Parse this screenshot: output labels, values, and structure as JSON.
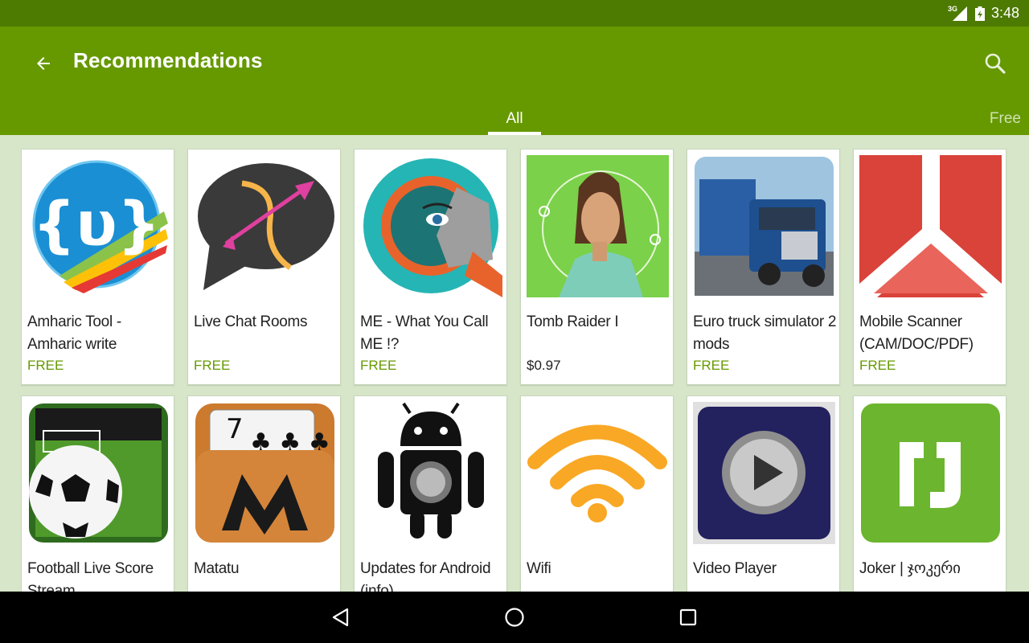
{
  "status": {
    "network": "3G",
    "time": "3:48"
  },
  "appbar": {
    "title": "Recommendations",
    "back_icon": "arrow-back-icon",
    "search_icon": "search-icon"
  },
  "tabs": [
    {
      "label": "All",
      "selected": true
    },
    {
      "label": "Free",
      "selected": false
    }
  ],
  "colors": {
    "status_bar": "#4d7a00",
    "app_bar": "#669900",
    "background": "#d7e6c9",
    "free_price": "#669900"
  },
  "apps": [
    {
      "name": "Amharic  Tool - Amharic write",
      "price": "FREE",
      "icon": "amharic-tool-icon"
    },
    {
      "name": "Live Chat Rooms",
      "price": "FREE",
      "icon": "live-chat-rooms-icon"
    },
    {
      "name": "ME - What You Call ME !?",
      "price": "FREE",
      "icon": "me-what-you-call-me-icon"
    },
    {
      "name": "Tomb Raider I",
      "price": "$0.97",
      "icon": "tomb-raider-icon"
    },
    {
      "name": "Euro truck simulator 2 mods",
      "price": "FREE",
      "icon": "euro-truck-icon"
    },
    {
      "name": "Mobile Scanner (CAM/DOC/PDF)",
      "price": "FREE",
      "icon": "mobile-scanner-icon"
    },
    {
      "name": "Football Live Score Stream",
      "price": "",
      "icon": "football-icon"
    },
    {
      "name": "Matatu",
      "price": "",
      "icon": "matatu-icon"
    },
    {
      "name": "Updates for Android (info)",
      "price": "",
      "icon": "android-updates-icon"
    },
    {
      "name": "Wifi",
      "price": "",
      "icon": "wifi-icon"
    },
    {
      "name": "Video Player",
      "price": "",
      "icon": "video-player-icon"
    },
    {
      "name": "Joker | ჯოკერი",
      "price": "",
      "icon": "joker-icon"
    }
  ],
  "navigation": {
    "back": "nav-back-icon",
    "home": "nav-home-icon",
    "recents": "nav-recents-icon"
  }
}
